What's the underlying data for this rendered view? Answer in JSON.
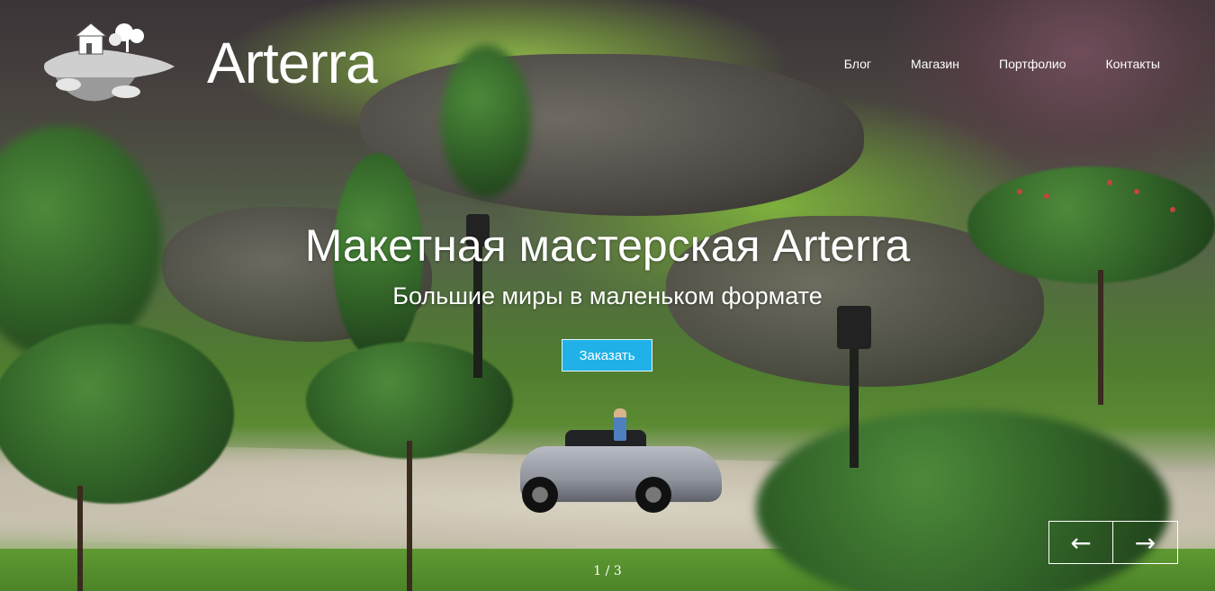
{
  "brand": {
    "name": "Arterra",
    "logo_icon": "turtle-island-logo-icon"
  },
  "nav": {
    "items": [
      "Блог",
      "Магазин",
      "Портфолио",
      "Контакты"
    ]
  },
  "hero": {
    "title": "Макетная мастерская Arterra",
    "subtitle": "Большие миры в маленьком формате",
    "cta_label": "Заказать"
  },
  "slider": {
    "prev_glyph": "←",
    "next_glyph": "→",
    "current": "1",
    "separator": "/",
    "total": "3"
  },
  "colors": {
    "accent": "#1fb1e8",
    "text": "#ffffff"
  }
}
